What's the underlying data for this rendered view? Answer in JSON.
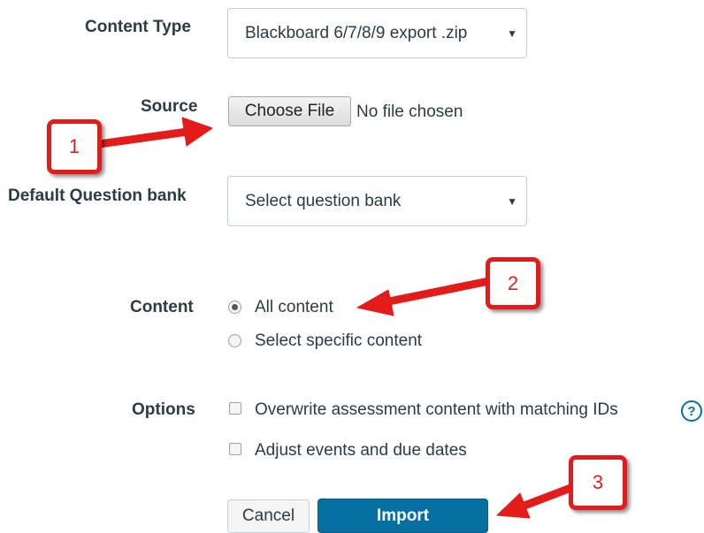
{
  "form": {
    "content_type": {
      "label": "Content Type",
      "value": "Blackboard 6/7/8/9 export .zip"
    },
    "source": {
      "label": "Source",
      "button_label": "Choose File",
      "status": "No file chosen"
    },
    "question_bank": {
      "label": "Default Question bank",
      "value": "Select question bank"
    },
    "content": {
      "label": "Content",
      "options": [
        {
          "label": "All content",
          "selected": true
        },
        {
          "label": "Select specific content",
          "selected": false
        }
      ]
    },
    "options": {
      "label": "Options",
      "items": [
        {
          "label": "Overwrite assessment content with matching IDs",
          "checked": false
        },
        {
          "label": "Adjust events and due dates",
          "checked": false
        }
      ],
      "help_glyph": "?"
    },
    "actions": {
      "cancel_label": "Cancel",
      "import_label": "Import"
    }
  },
  "annotations": [
    {
      "number": "1"
    },
    {
      "number": "2"
    },
    {
      "number": "3"
    }
  ],
  "colors": {
    "accent": "#0770a3",
    "annotation": "#e31b1b",
    "text": "#2d3b45"
  },
  "icons": {
    "dropdown": "caret-down-icon",
    "help": "help-circle-icon"
  }
}
